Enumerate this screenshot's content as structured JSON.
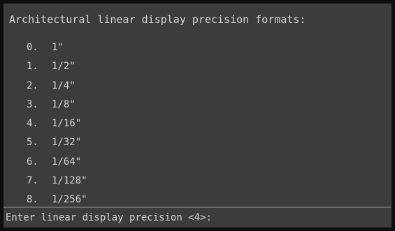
{
  "history": {
    "title": "Architectural linear display precision formats:",
    "options": [
      {
        "index": "0.",
        "label": "1\""
      },
      {
        "index": "1.",
        "label": "1/2\""
      },
      {
        "index": "2.",
        "label": "1/4\""
      },
      {
        "index": "3.",
        "label": "1/8\""
      },
      {
        "index": "4.",
        "label": "1/16\""
      },
      {
        "index": "5.",
        "label": "1/32\""
      },
      {
        "index": "6.",
        "label": "1/64\""
      },
      {
        "index": "7.",
        "label": "1/128\""
      },
      {
        "index": "8.",
        "label": "1/256\""
      }
    ]
  },
  "command_line": {
    "prompt": "Enter linear display precision <4>:",
    "value": ""
  },
  "colors": {
    "panel_background": "#3c3c3c",
    "text": "#d4d4d4",
    "frame": "#0e0e0e"
  }
}
